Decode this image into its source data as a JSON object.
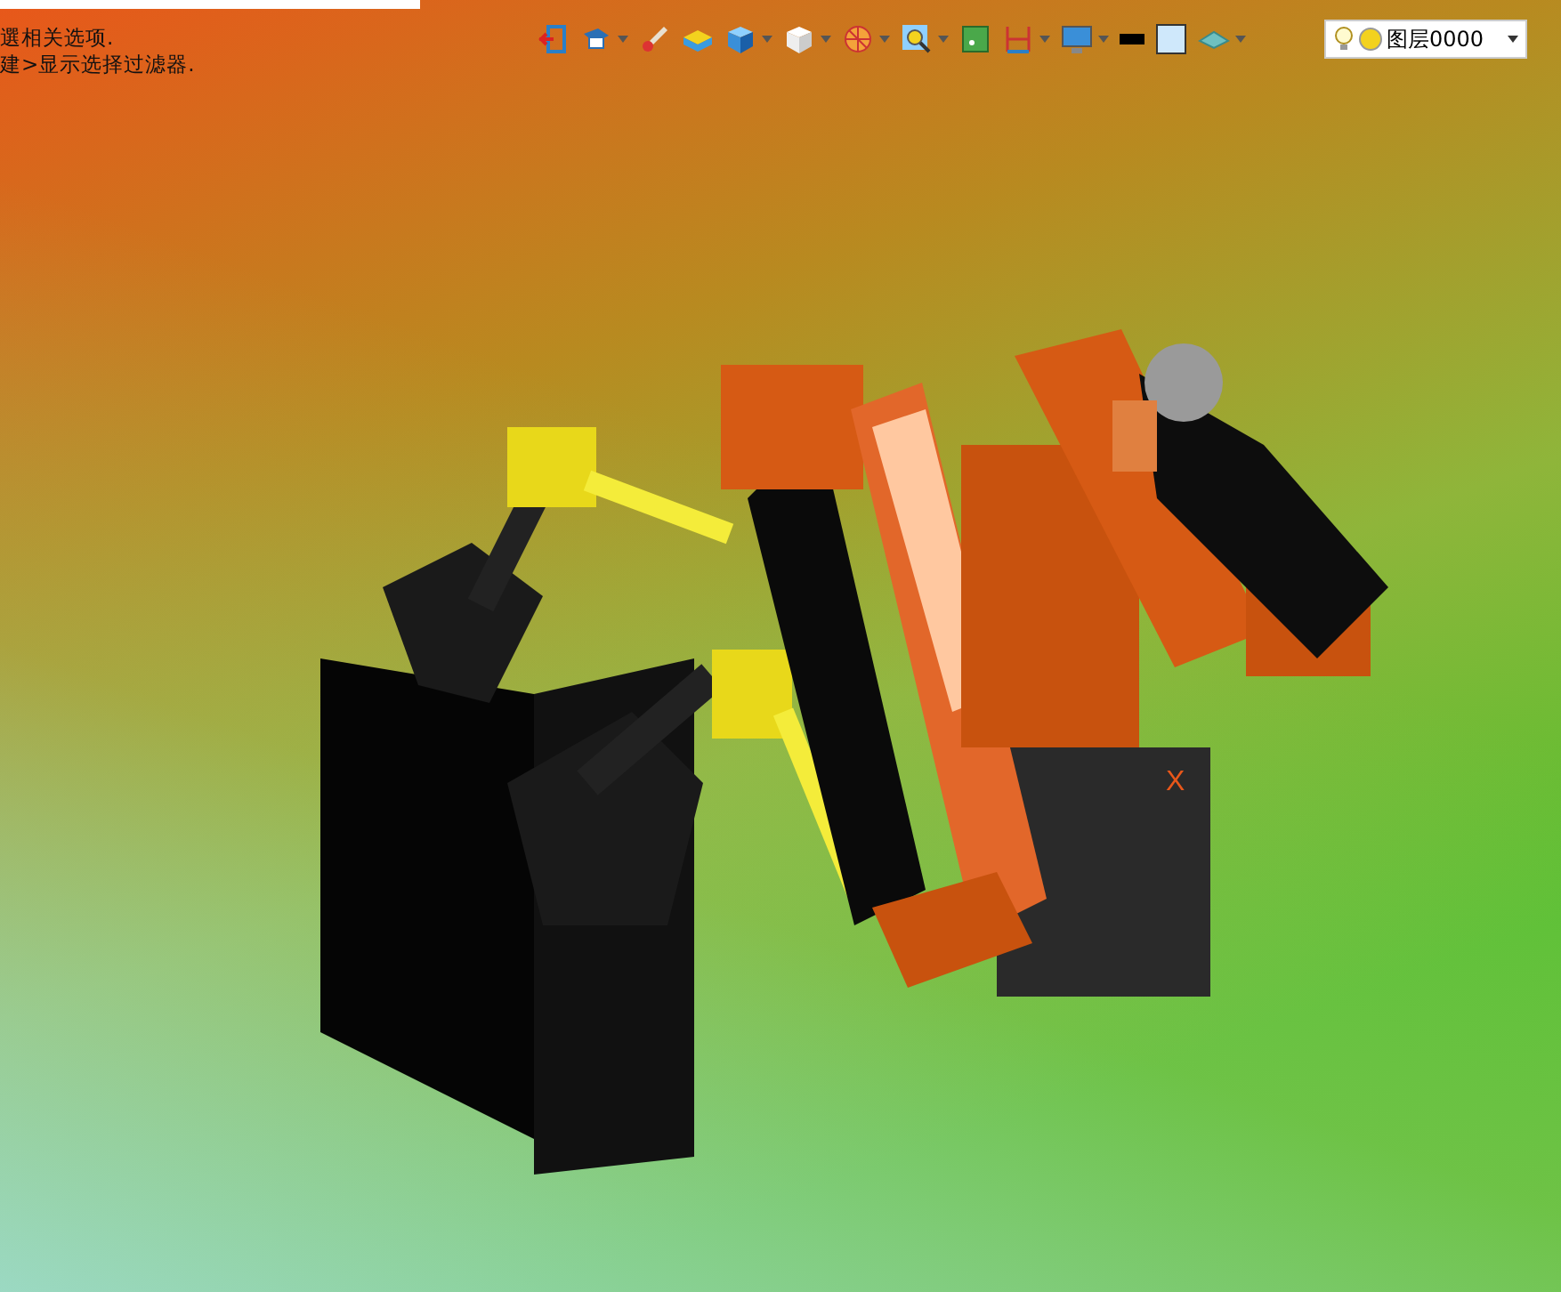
{
  "hints": [
    "選相关选项.",
    "建>显示选择过滤器."
  ],
  "toolbar": [
    {
      "kind": "exit",
      "dropdown": false
    },
    {
      "kind": "view",
      "dropdown": true
    },
    {
      "kind": "brush",
      "dropdown": false
    },
    {
      "kind": "box",
      "dropdown": false
    },
    {
      "kind": "cube-blue",
      "dropdown": true
    },
    {
      "kind": "cube-white",
      "dropdown": true
    },
    {
      "kind": "section",
      "dropdown": true
    },
    {
      "kind": "zoom",
      "dropdown": true
    },
    {
      "kind": "frame",
      "dropdown": false
    },
    {
      "kind": "measure",
      "dropdown": true
    },
    {
      "kind": "monitor",
      "dropdown": true
    },
    {
      "kind": "line",
      "dropdown": false
    },
    {
      "kind": "swatch",
      "dropdown": false
    },
    {
      "kind": "layers",
      "dropdown": true
    }
  ],
  "layer_select": {
    "value": "图层0000"
  },
  "axis_label": "X"
}
